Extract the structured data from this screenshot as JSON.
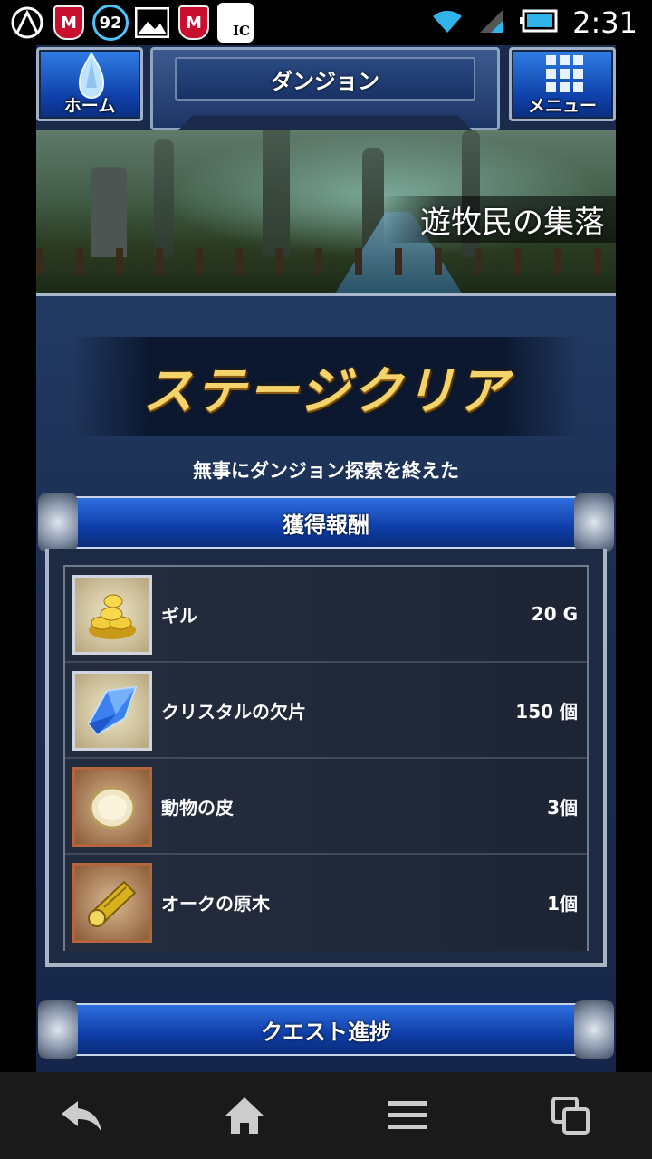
{
  "status_bar": {
    "battery_level": "92",
    "ic_label": "IC",
    "m_label": "M",
    "time": "2:31"
  },
  "header": {
    "home_label": "ホーム",
    "title": "ダンジョン",
    "menu_label": "メニュー"
  },
  "banner": {
    "location": "遊牧民の集落"
  },
  "result": {
    "title": "ステージクリア",
    "message": "無事にダンジョン探索を終えた"
  },
  "rewards": {
    "header": "獲得報酬",
    "items": [
      {
        "name": "ギル",
        "quantity": "20 G",
        "icon": "gil-coins-icon"
      },
      {
        "name": "クリスタルの欠片",
        "quantity": "150 個",
        "icon": "crystal-shard-icon"
      },
      {
        "name": "動物の皮",
        "quantity": "3個",
        "icon": "animal-hide-icon"
      },
      {
        "name": "オークの原木",
        "quantity": "1個",
        "icon": "oak-log-icon"
      }
    ]
  },
  "quest": {
    "header": "クエスト進捗"
  },
  "colors": {
    "accent_blue": "#1a4fc4",
    "gold_text": "#f4d46a",
    "panel_bg": "#1e2636"
  }
}
